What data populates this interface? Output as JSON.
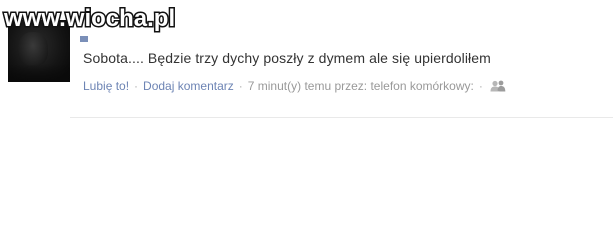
{
  "watermark": {
    "text": "www.wiocha.pl"
  },
  "post": {
    "message": "Sobota.... Będzie trzy dychy poszły z dymem ale się upierdoliłem",
    "actions": {
      "like_label": "Lubię to!",
      "comment_label": "Dodaj komentarz"
    },
    "timestamp_text": "7 minut(y) temu przez: telefon komórkowy:",
    "separator": "·",
    "privacy_icon": "friends-icon"
  },
  "colors": {
    "link": "#6d84b4",
    "meta": "#999999",
    "message": "#333333"
  }
}
